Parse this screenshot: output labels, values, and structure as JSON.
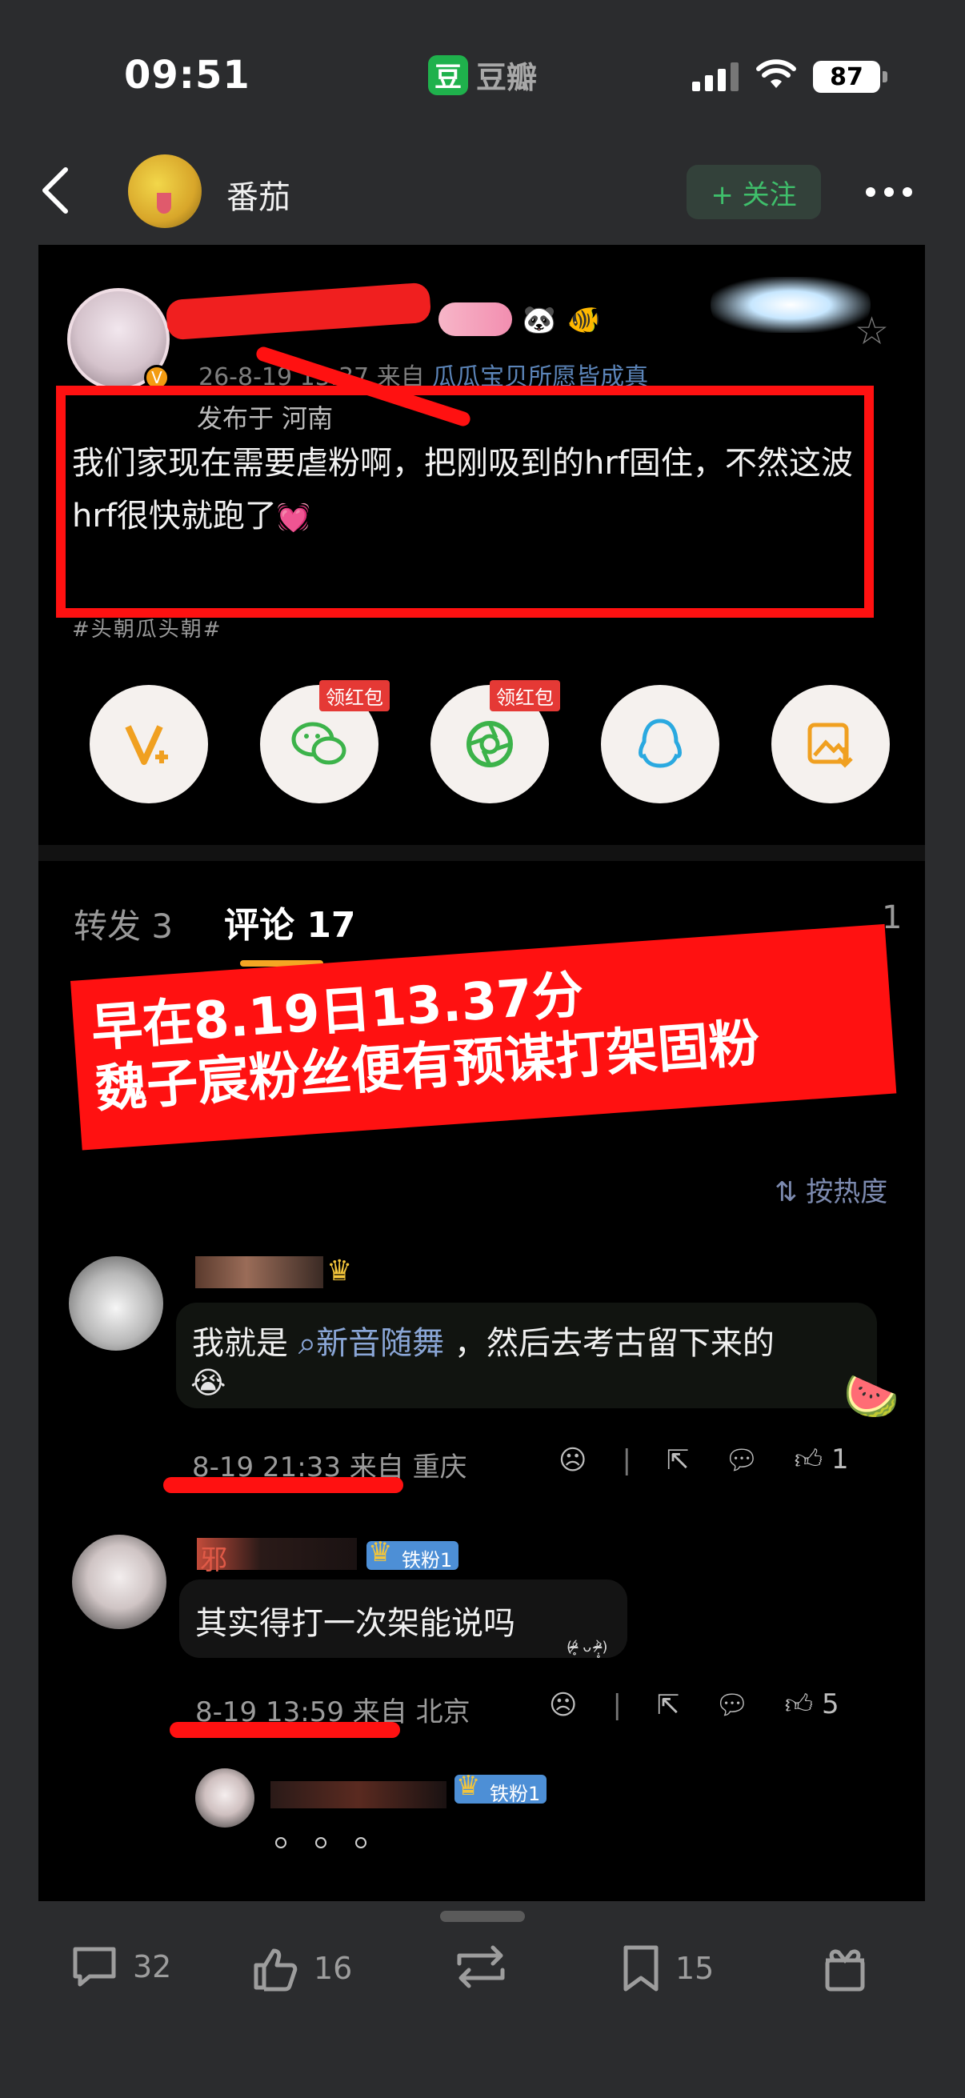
{
  "status_bar": {
    "time": "09:51",
    "app_name": "豆瓣",
    "app_logo": "豆",
    "battery": "87"
  },
  "nav": {
    "title": "番茄",
    "follow_label": "+ 关注"
  },
  "post": {
    "time": "26-8-19 13:37",
    "source_prefix": "来自",
    "source": "瓜瓜宝贝所愿皆成真",
    "location": "发布于 河南",
    "text": "我们家现在需要虐粉啊，把刚吸到的hrf固住，不然这波hrf很快就跑了",
    "tag": "#头朝瓜头朝#",
    "share_badge": "领红包"
  },
  "tabs": {
    "repost": "转发 3",
    "comment": "评论 17",
    "like_tail": "1"
  },
  "banner": {
    "line1": "早在8.19日13.37分",
    "line2": "魏子宸粉丝便有预谋打架固粉"
  },
  "sort": {
    "label": "⇅ 按热度"
  },
  "comments": [
    {
      "text_before": "我就是",
      "link": "新音随舞",
      "text_after": "，然后去考古留下来的",
      "time": "8-19 21:33",
      "origin": "来自 重庆",
      "likes": "1"
    },
    {
      "name_initial": "邪",
      "badge": "铁粉1",
      "text": "其实得打一次架能说吗",
      "mini": "(ᵒ̴̶̷̥́ ᴗ ᵒ̴̶̷̣̥̀)",
      "time": "8-19 13:59",
      "origin": "来自 北京",
      "likes": "5"
    },
    {
      "badge": "铁粉1"
    }
  ],
  "bottom_bar": {
    "comments": "32",
    "likes": "16",
    "bookmarks": "15"
  },
  "colors": {
    "accent_red": "#ff1111",
    "follow_green": "#3fbf6b",
    "link_blue": "#8aa6d6",
    "badge_blue": "#4d8fd6"
  }
}
